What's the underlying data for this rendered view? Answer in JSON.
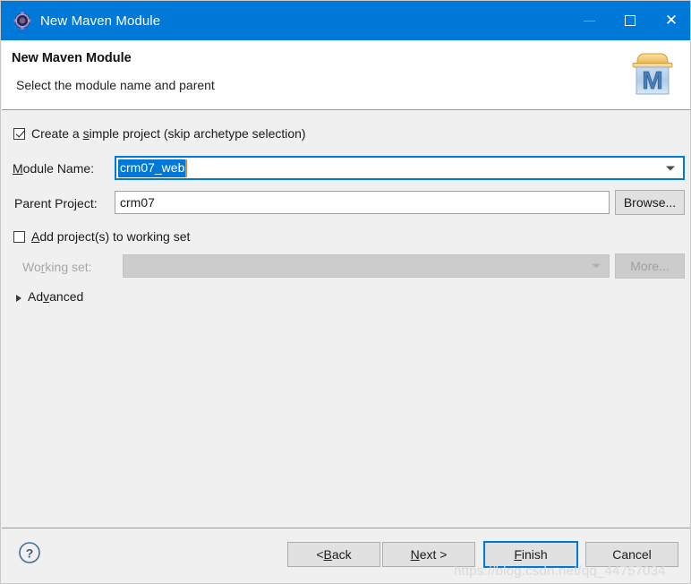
{
  "window": {
    "title": "New Maven Module",
    "icon": "maven-gear-icon",
    "accent_color": "#0078d7",
    "body_color": "#f0f0f0",
    "controls": {
      "minimize": "minimize-icon",
      "maximize": "maximize-icon",
      "close": "close-icon"
    }
  },
  "header": {
    "title": "New Maven Module",
    "subtitle": "Select the module name and parent",
    "logo": "maven-module-icon",
    "logo_letter": "M"
  },
  "form": {
    "simple_project": {
      "label": "Create a simple project (skip archetype selection)",
      "checked": true
    },
    "module_name": {
      "label": "Module Name:",
      "value": "crm07_web",
      "selected": true
    },
    "parent_project": {
      "label": "Parent Project:",
      "value": "crm07",
      "browse_label": "Browse..."
    },
    "working_set_checkbox": {
      "label": "Add project(s) to working set",
      "checked": false
    },
    "working_set": {
      "label": "Working set:",
      "value": "",
      "more_label": "More...",
      "enabled": false
    },
    "advanced": {
      "label": "Advanced",
      "expanded": false
    }
  },
  "footer": {
    "help": "help-icon",
    "buttons": {
      "back": "< Back",
      "next": "Next >",
      "finish": "Finish",
      "cancel": "Cancel"
    }
  },
  "watermark": {
    "text": "https://blog.csdn.net/qq_44757034"
  }
}
